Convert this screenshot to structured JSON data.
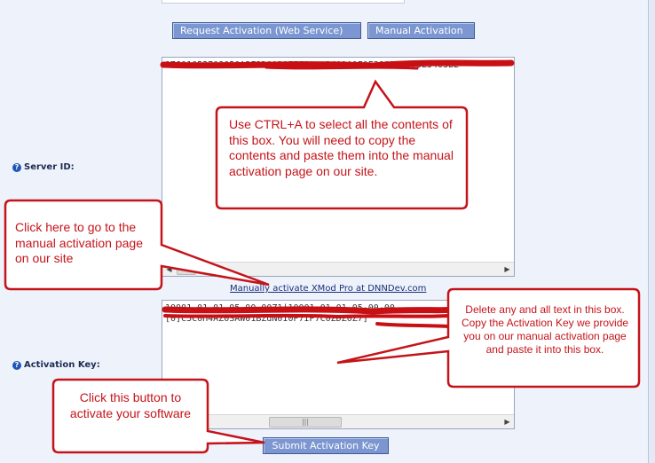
{
  "buttons": {
    "request_activation": "Request Activation (Web Service)",
    "manual_activation": "Manual Activation",
    "submit_activation_key": "Submit Activation Key"
  },
  "labels": {
    "server_id": "Server ID:",
    "activation_key": "Activation Key:"
  },
  "server_id_box": {
    "value": "17601052703050A3F3D0A30F7F3...34A1A0F0E3100C01E3E5403B2"
  },
  "activation_key_box": {
    "value_line1": "10001-01-01-05-00-00Z1|10001-01-01-05-00-00",
    "value_line2": "[0]C5C0H4AZ0SAW01BZdN0I0P7IP7C0ZDZ0Z7]"
  },
  "link": {
    "manual_activate": "Manually activate XMod Pro at DNNDev.com"
  },
  "callouts": {
    "select_all": "Use CTRL+A to select all the contents of this box. You will need to copy the contents and paste them into the manual activation page on our site.",
    "click_here": "Click here to go to the manual activation page on our site",
    "delete_text": "Delete any and all text in this box. Copy the Activation Key we provide you on our manual activation page and paste it into this box.",
    "click_button": "Click this button to activate your software"
  },
  "icons": {
    "help": "help-icon",
    "scroll_left": "scroll-left-arrow",
    "scroll_right": "scroll-right-arrow"
  },
  "colors": {
    "callout_border": "#c4141a",
    "callout_text": "#c4141a",
    "button_bg": "#7b96d0",
    "redaction": "#c80f14"
  }
}
